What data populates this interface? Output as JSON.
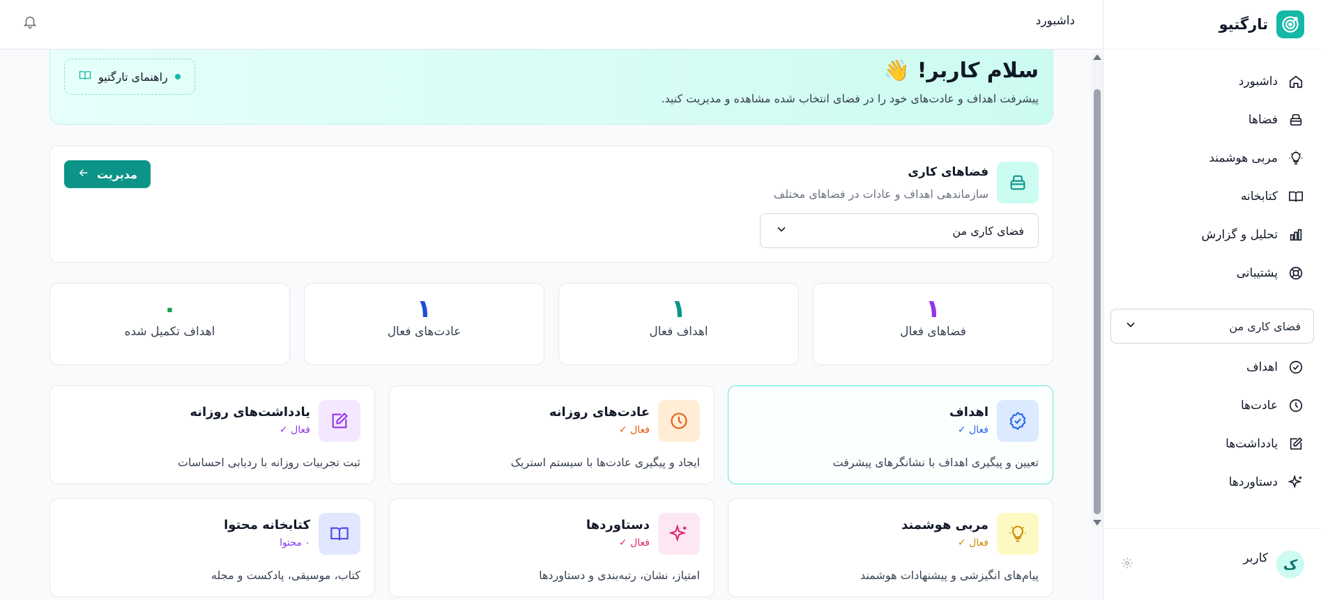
{
  "app": {
    "name": "تارگتیو"
  },
  "header": {
    "title": "داشبورد"
  },
  "sidebar": {
    "nav": [
      {
        "label": "داشبورد",
        "icon": "home-icon"
      },
      {
        "label": "فضاها",
        "icon": "layers-icon"
      },
      {
        "label": "مربی هوشمند",
        "icon": "lightbulb-icon"
      },
      {
        "label": "کتابخانه",
        "icon": "book-icon"
      },
      {
        "label": "تحلیل و گزارش",
        "icon": "bar-chart-icon"
      },
      {
        "label": "پشتیبانی",
        "icon": "lifebuoy-icon"
      }
    ],
    "workspace_select": "فضای کاری من",
    "workspace_nav": [
      {
        "label": "اهداف",
        "icon": "check-circle-icon"
      },
      {
        "label": "عادت‌ها",
        "icon": "clock-icon"
      },
      {
        "label": "یادداشت‌ها",
        "icon": "edit-icon"
      },
      {
        "label": "دستاوردها",
        "icon": "sparkles-icon"
      }
    ],
    "user": {
      "initial": "ک",
      "name": "کاربر"
    }
  },
  "welcome": {
    "title": "سلام کاربر! 👋",
    "subtitle": "پیشرفت اهداف و عادت‌های خود را در فضای انتخاب شده مشاهده و مدیریت کنید.",
    "guide_label": "راهنمای تارگتیو"
  },
  "workspaces": {
    "title": "فضاهای کاری",
    "subtitle": "سازماندهی اهداف و عادات در فضاهای مختلف",
    "manage_label": "مدیریت",
    "selected": "فضای کاری من"
  },
  "stats": [
    {
      "value": "۱",
      "label": "فضاهای فعال",
      "color": "#9333ea"
    },
    {
      "value": "۱",
      "label": "اهداف فعال",
      "color": "#0d9488"
    },
    {
      "value": "۱",
      "label": "عادت‌های فعال",
      "color": "#1d4ed8"
    },
    {
      "value": "۰",
      "label": "اهداف تکمیل شده",
      "color": "#16a34a"
    }
  ],
  "features": [
    {
      "title": "اهداف",
      "badge": "فعال ✓",
      "desc": "تعیین و پیگیری اهداف با نشانگرهای پیشرفت",
      "icon": "badge-check-icon",
      "icon_bg": "#dbeafe",
      "icon_color": "#2563eb",
      "badge_color": "#2563eb"
    },
    {
      "title": "عادت‌های روزانه",
      "badge": "فعال ✓",
      "desc": "ایجاد و پیگیری عادت‌ها با سیستم استریک",
      "icon": "clock-icon",
      "icon_bg": "#ffedd5",
      "icon_color": "#ea580c",
      "badge_color": "#ea580c"
    },
    {
      "title": "یادداشت‌های روزانه",
      "badge": "فعال ✓",
      "desc": "ثبت تجربیات روزانه با ردیابی احساسات",
      "icon": "edit-icon",
      "icon_bg": "#f3e8ff",
      "icon_color": "#9333ea",
      "badge_color": "#9333ea"
    },
    {
      "title": "مربی هوشمند",
      "badge": "فعال ✓",
      "desc": "پیام‌های انگیزشی و پیشنهادات هوشمند",
      "icon": "lightbulb-icon",
      "icon_bg": "#fef9c3",
      "icon_color": "#ca8a04",
      "badge_color": "#ca8a04"
    },
    {
      "title": "دستاوردها",
      "badge": "فعال ✓",
      "desc": "امتیاز، نشان، رتبه‌بندی و دستاوردها",
      "icon": "sparkles-icon",
      "icon_bg": "#fce7f3",
      "icon_color": "#db2777",
      "badge_color": "#db2777"
    },
    {
      "title": "کتابخانه محتوا",
      "badge": "۰ محتوا",
      "desc": "کتاب، موسیقی، پادکست و مجله",
      "icon": "book-open-icon",
      "icon_bg": "#e0e7ff",
      "icon_color": "#4f46e5",
      "badge_color": "#7c3aed"
    }
  ]
}
